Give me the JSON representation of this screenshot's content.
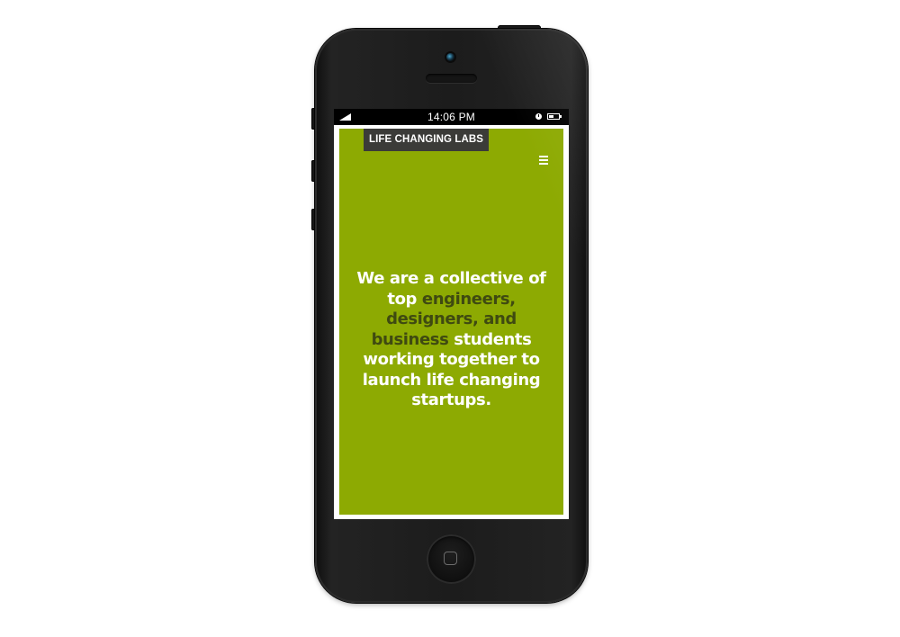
{
  "status_bar": {
    "time": "14:06 PM",
    "signal_icon": "signal-icon",
    "alarm_icon": "alarm-clock-icon",
    "battery_icon": "battery-icon"
  },
  "site": {
    "logo": "LIFE CHANGING LABS",
    "menu_icon": "hamburger-menu-icon",
    "hero": {
      "line1": "We are a collective of",
      "line2_a": "top ",
      "line2_b": "engineers,",
      "line3": "designers, and",
      "line4_a": "business",
      "line4_b": " students",
      "line5": "working together to",
      "line6": "launch life changing",
      "line7": "startups."
    }
  },
  "colors": {
    "panel_green": "#8daa02",
    "highlight_dark": "#3f4a11",
    "logo_bg": "#3b3b38",
    "phone_body": "#1c1c1c"
  },
  "device": {
    "home_button_icon": "home-button-icon",
    "camera_icon": "front-camera-icon",
    "speaker_icon": "earpiece-speaker-icon"
  }
}
